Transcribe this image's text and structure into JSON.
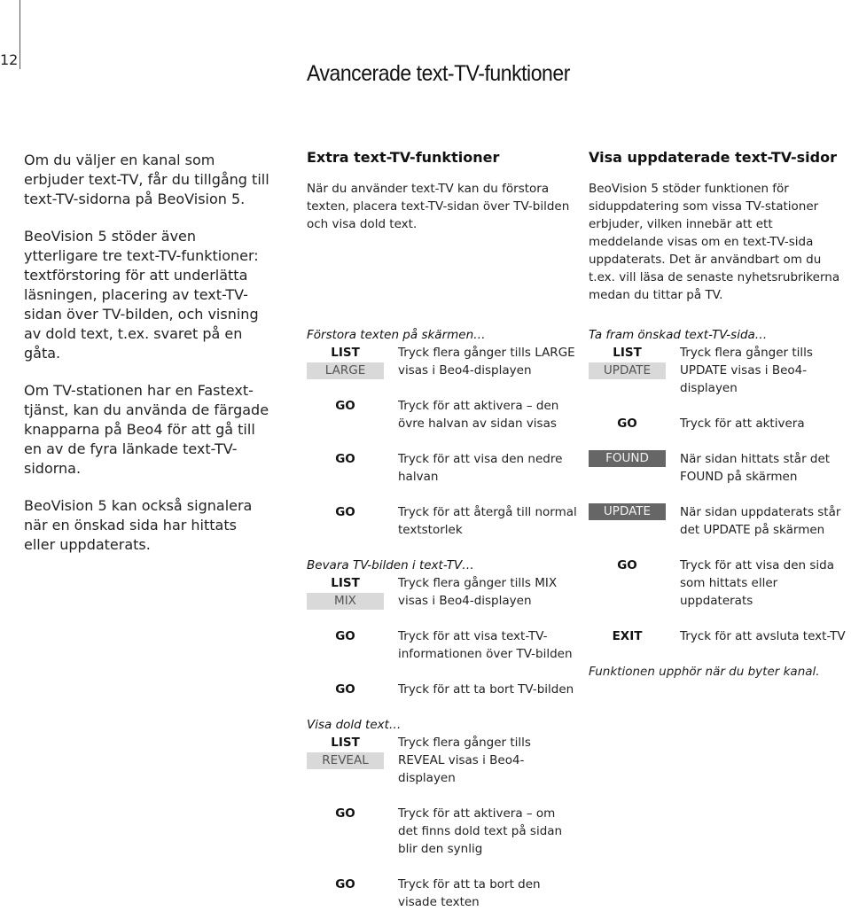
{
  "page": {
    "number": "12",
    "title": "Avancerade text-TV-funktioner"
  },
  "intro": {
    "paragraphs": [
      "Om du väljer en kanal som erbjuder text-TV, får du tillgång till text-TV-sidorna på BeoVision 5.",
      "BeoVision 5 stöder även ytterligare tre text-TV-funktioner: textförstoring för att underlätta läsningen, placering av text-TV-sidan över TV-bilden, och visning av dold text, t.ex. svaret på en gåta.",
      "Om TV-stationen har en Fastext-tjänst, kan du använda de färgade knapparna på Beo4 för att gå till en av de fyra länkade text-TV-sidorna.",
      "BeoVision 5 kan också signalera när en önskad sida har hittats eller uppdaterats."
    ]
  },
  "extra": {
    "heading": "Extra text-TV-funktioner",
    "lead": "När du använder text-TV kan du förstora texten, placera text-TV-sidan över TV-bilden och visa dold text.",
    "enlarge": {
      "title": "Förstora texten på skärmen…",
      "steps": [
        {
          "key": "LIST",
          "display": "LARGE",
          "text": "Tryck flera gånger tills LARGE visas i Beo4-displayen"
        },
        {
          "key": "GO",
          "text": "Tryck för att aktivera – den övre halvan av sidan visas"
        },
        {
          "key": "GO",
          "text": "Tryck för att visa den nedre halvan"
        },
        {
          "key": "GO",
          "text": "Tryck för att återgå till normal textstorlek"
        }
      ]
    },
    "mix": {
      "title": "Bevara TV-bilden i text-TV…",
      "steps": [
        {
          "key": "LIST",
          "display": "MIX",
          "text": "Tryck flera gånger tills MIX visas i Beo4-displayen"
        },
        {
          "key": "GO",
          "text": "Tryck för att visa text-TV-informationen över TV-bilden"
        },
        {
          "key": "GO",
          "text": "Tryck för att ta bort TV-bilden"
        }
      ]
    },
    "reveal": {
      "title": "Visa dold text…",
      "steps": [
        {
          "key": "LIST",
          "display": "REVEAL",
          "text": "Tryck flera gånger tills REVEAL visas i Beo4-displayen"
        },
        {
          "key": "GO",
          "text": "Tryck för att aktivera – om det finns dold text på sidan blir den synlig"
        },
        {
          "key": "GO",
          "text": "Tryck för att ta bort den visade texten"
        }
      ]
    }
  },
  "update": {
    "heading": "Visa uppdaterade text-TV-sidor",
    "lead": "BeoVision 5 stöder funktionen för siduppdatering som vissa TV-stationer erbjuder, vilken innebär att ett meddelande visas om en text-TV-sida uppdaterats. Det är användbart om du t.ex. vill läsa de senaste nyhetsrubrikerna medan du tittar på TV.",
    "fetch": {
      "title": "Ta fram önskad text-TV-sida…",
      "steps": [
        {
          "key": "LIST",
          "display": "UPDATE",
          "text": "Tryck flera gånger tills UPDATE visas i Beo4-displayen"
        },
        {
          "key": "GO",
          "text": "Tryck för att aktivera"
        },
        {
          "osd": "FOUND",
          "text": "När sidan hittats står det FOUND på skärmen"
        },
        {
          "osd": "UPDATE",
          "text": "När sidan uppdaterats står det UPDATE på skärmen"
        },
        {
          "key": "GO",
          "text": "Tryck för att visa den sida som hittats eller uppdaterats"
        },
        {
          "key": "EXIT",
          "text": "Tryck för att avsluta text-TV"
        }
      ]
    },
    "note": "Funktionen upphör när du byter kanal."
  }
}
